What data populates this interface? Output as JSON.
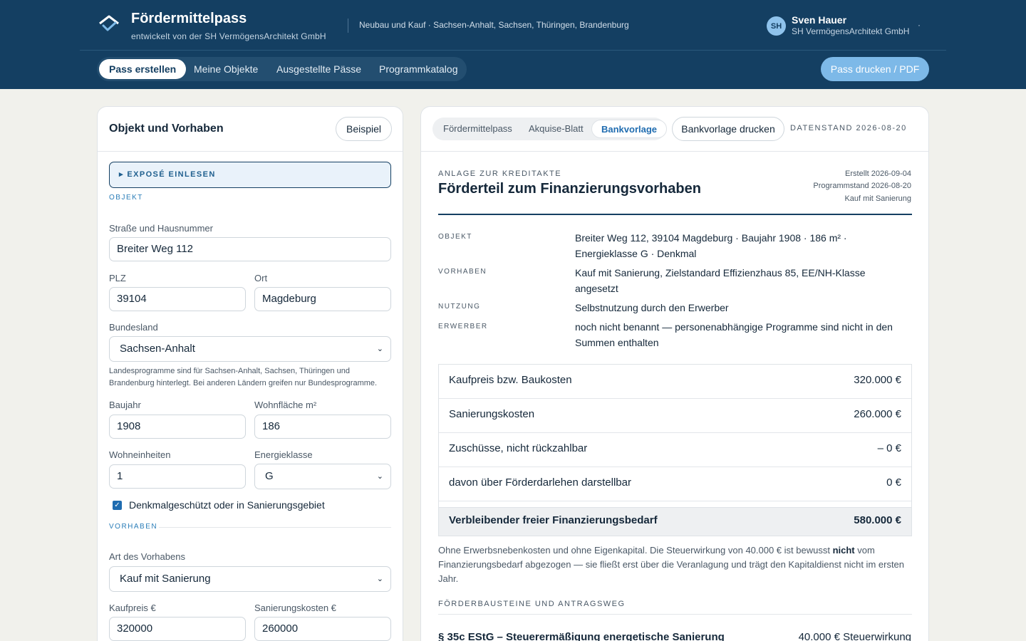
{
  "header": {
    "title": "Fördermittelpass",
    "subtitle": "entwickelt von der SH VermögensArchitekt GmbH",
    "scope": "Neubau und Kauf · Sachsen-Anhalt, Sachsen, Thüringen, Brandenburg",
    "user": {
      "initials": "SH",
      "name": "Sven Hauer",
      "org": "SH VermögensArchitekt GmbH",
      "menu": "·"
    },
    "nav": [
      "Pass erstellen",
      "Meine Objekte",
      "Ausgestellte Pässe",
      "Programmkatalog"
    ],
    "print_label": "Pass drucken / PDF"
  },
  "form": {
    "title": "Objekt und Vorhaben",
    "example_label": "Beispiel",
    "expose_label": "▸ EXPOSÉ EINLESEN",
    "section_objekt": "OBJEKT",
    "street_label": "Straße und Hausnummer",
    "street_value": "Breiter Weg 112",
    "plz_label": "PLZ",
    "plz_value": "39104",
    "ort_label": "Ort",
    "ort_value": "Magdeburg",
    "bundesland_label": "Bundesland",
    "bundesland_value": "Sachsen-Anhalt",
    "hint": "Landesprogramme sind für Sachsen-Anhalt, Sachsen, Thüringen und Brandenburg hinterlegt. Bei anderen Ländern greifen nur Bundesprogramme.",
    "baujahr_label": "Baujahr",
    "baujahr_value": "1908",
    "wohnflaeche_label": "Wohnfläche m²",
    "wohnflaeche_value": "186",
    "wohneinheiten_label": "Wohneinheiten",
    "wohneinheiten_value": "1",
    "energieklasse_label": "Energieklasse",
    "energieklasse_value": "G",
    "denkmal_label": "Denkmalgeschützt oder in Sanierungsgebiet",
    "section_vorhaben": "VORHABEN",
    "art_label": "Art des Vorhabens",
    "art_value": "Kauf mit Sanierung",
    "kaufpreis_label": "Kaufpreis €",
    "kaufpreis_value": "320000",
    "sanierung_label": "Sanierungskosten €",
    "sanierung_value": "260000"
  },
  "report": {
    "tabs": [
      "Fördermittelpass",
      "Akquise-Blatt",
      "Bankvorlage"
    ],
    "bank_print_label": "Bankvorlage drucken",
    "datenstand": "DATENSTAND 2026-08-20",
    "kicker": "ANLAGE ZUR KREDITAKTE",
    "title": "Förderteil zum Finanzierungsvorhaben",
    "meta": [
      "Erstellt 2026-09-04",
      "Programmstand 2026-08-20",
      "Kauf mit Sanierung"
    ],
    "info": [
      {
        "key": "OBJEKT",
        "value": "Breiter Weg 112, 39104 Magdeburg · Baujahr 1908 · 186 m² · Energieklasse G · Denkmal"
      },
      {
        "key": "VORHABEN",
        "value": "Kauf mit Sanierung, Zielstandard Effizienzhaus 85, EE/NH-Klasse angesetzt"
      },
      {
        "key": "NUTZUNG",
        "value": "Selbstnutzung durch den Erwerber"
      },
      {
        "key": "ERWERBER",
        "value": "noch nicht benannt — personenabhängige Programme sind nicht in den Summen enthalten"
      }
    ],
    "table": [
      {
        "label": "Kaufpreis bzw. Baukosten",
        "value": "320.000 €"
      },
      {
        "label": "Sanierungskosten",
        "value": "260.000 €"
      },
      {
        "label": "Zuschüsse, nicht rückzahlbar",
        "value": "– 0 €"
      },
      {
        "label": "davon über Förderdarlehen darstellbar",
        "value": "0 €"
      }
    ],
    "total": {
      "label": "Verbleibender freier Finanzierungsbedarf",
      "value": "580.000 €"
    },
    "note_pre": "Ohne Erwerbsnebenkosten und ohne Eigenkapital. Die Steuerwirkung von 40.000 € ist bewusst ",
    "note_bold": "nicht",
    "note_post": " vom Finanzierungsbedarf abgezogen — sie fließt erst über die Veranlagung und trägt den Kapitaldienst nicht im ersten Jahr.",
    "section2": "FÖRDERBAUSTEINE UND ANTRAGSWEG",
    "program_title": "§ 35c EStG – Steuerermäßigung energetische Sanierung",
    "program_value": "40.000 € Steuerwirkung"
  }
}
